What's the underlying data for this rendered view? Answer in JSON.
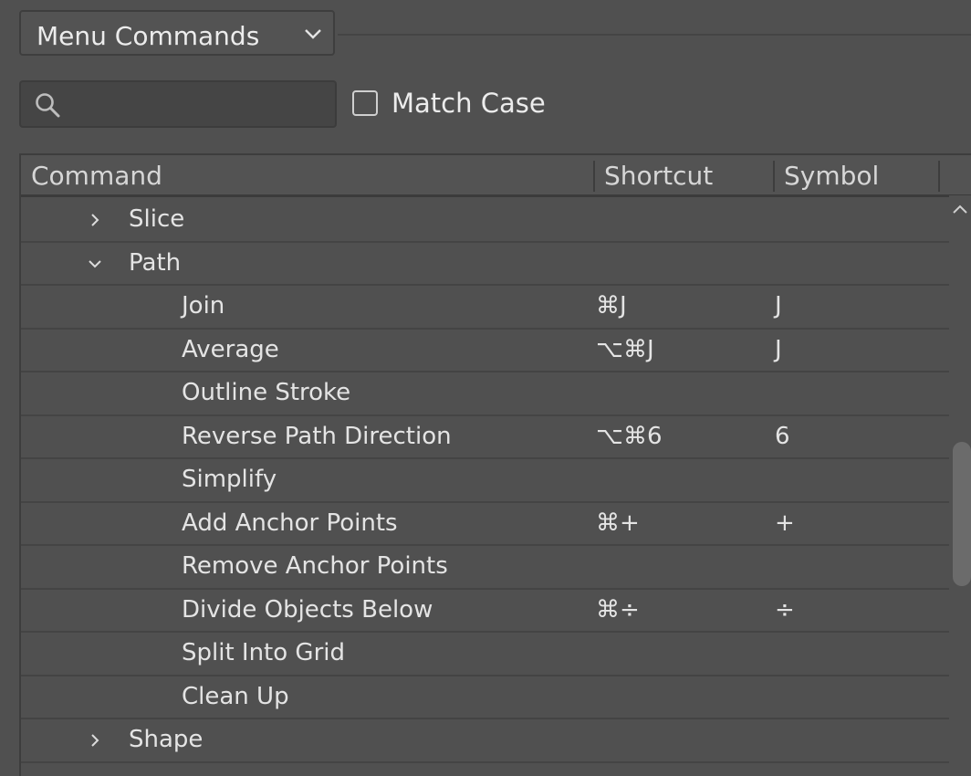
{
  "dropdown": {
    "label": "Menu Commands",
    "icon": "chevron-down-icon"
  },
  "search": {
    "placeholder": "",
    "value": "",
    "icon": "search-icon"
  },
  "match_case": {
    "label": "Match Case",
    "checked": false
  },
  "table": {
    "columns": [
      "Command",
      "Shortcut",
      "Symbol"
    ],
    "rows": [
      {
        "command": "Slice",
        "shortcut": "",
        "symbol": "",
        "type": "group",
        "expanded": false
      },
      {
        "command": "Path",
        "shortcut": "",
        "symbol": "",
        "type": "group",
        "expanded": true
      },
      {
        "command": "Join",
        "shortcut": "⌘J",
        "symbol": "J",
        "type": "item"
      },
      {
        "command": "Average",
        "shortcut": "⌥⌘J",
        "symbol": "J",
        "type": "item"
      },
      {
        "command": "Outline Stroke",
        "shortcut": "",
        "symbol": "",
        "type": "item"
      },
      {
        "command": "Reverse Path Direction",
        "shortcut": "⌥⌘6",
        "symbol": "6",
        "type": "item"
      },
      {
        "command": "Simplify",
        "shortcut": "",
        "symbol": "",
        "type": "item"
      },
      {
        "command": "Add Anchor Points",
        "shortcut": "⌘+",
        "symbol": "+",
        "type": "item"
      },
      {
        "command": "Remove Anchor Points",
        "shortcut": "",
        "symbol": "",
        "type": "item"
      },
      {
        "command": "Divide Objects Below",
        "shortcut": "⌘÷",
        "symbol": "÷",
        "type": "item"
      },
      {
        "command": "Split Into Grid",
        "shortcut": "",
        "symbol": "",
        "type": "item"
      },
      {
        "command": "Clean Up",
        "shortcut": "",
        "symbol": "",
        "type": "item"
      },
      {
        "command": "Shape",
        "shortcut": "",
        "symbol": "",
        "type": "group",
        "expanded": false
      }
    ]
  },
  "colors": {
    "background": "#505050",
    "text": "#e4e4e4",
    "scrollbar_thumb": "#6b6b6b"
  }
}
